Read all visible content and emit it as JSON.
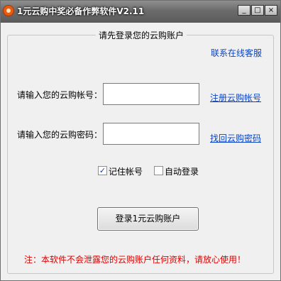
{
  "window": {
    "title": "1元云购中奖必备作弊软件V2.11",
    "controls": {
      "minimize": "_",
      "maximize": "□",
      "close": "×"
    }
  },
  "login": {
    "group_caption": "请先登录您的云购账户",
    "contact_link": "联系在线客服",
    "account_label": "请输入您的云购帐号：",
    "account_value": "",
    "register_link": "注册云购帐号",
    "password_label": "请输入您的云购密码：",
    "password_value": "",
    "recover_link": "找回云购密码",
    "remember_label": "记住帐号",
    "remember_checked": true,
    "autologin_label": "自动登录",
    "autologin_checked": false,
    "submit_label": "登录1元云购账户",
    "notice": "注：本软件不会泄露您的云购账户任何资料，请放心使用！"
  },
  "colors": {
    "link": "#0a44c6",
    "notice": "#e00000",
    "title_bar": "#6b6b6b",
    "app_icon": "#e85a12"
  }
}
